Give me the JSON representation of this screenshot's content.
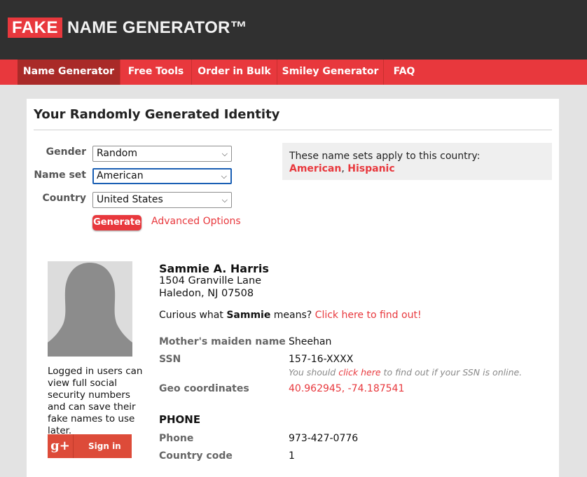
{
  "header": {
    "logo_fake": "FAKE",
    "logo_rest": "NAME GENERATOR™"
  },
  "nav": {
    "items": [
      {
        "label": "Name Generator",
        "active": true
      },
      {
        "label": "Free Tools"
      },
      {
        "label": "Order in Bulk"
      },
      {
        "label": "Smiley Generator"
      },
      {
        "label": "FAQ"
      }
    ]
  },
  "main": {
    "title": "Your Randomly Generated Identity"
  },
  "form": {
    "gender_label": "Gender",
    "gender_value": "Random",
    "nameset_label": "Name set",
    "nameset_value": "American",
    "country_label": "Country",
    "country_value": "United States",
    "generate_label": "Generate",
    "advanced_label": "Advanced Options"
  },
  "info": {
    "text": "These name sets apply to this country:",
    "link1": "American",
    "sep": ",",
    "link2": "Hispanic"
  },
  "sidebar": {
    "login_note": "Logged in users can view full social security numbers and can save their fake names to use later.",
    "gplus_icon_text": "g+",
    "signin_label": "Sign in"
  },
  "identity": {
    "name": "Sammie A. Harris",
    "address_line1": "1504 Granville Lane",
    "address_line2": "Haledon, NJ 07508",
    "curious_prefix": "Curious what",
    "curious_name": "Sammie",
    "curious_mid": "means?",
    "curious_link": "Click here to find out!",
    "maiden_label": "Mother's maiden name",
    "maiden_value": "Sheehan",
    "ssn_label": "SSN",
    "ssn_value": "157-16-XXXX",
    "ssn_note_prefix": "You should",
    "ssn_note_link": "click here",
    "ssn_note_suffix": "to find out if your SSN is online.",
    "geo_label": "Geo coordinates",
    "geo_value": "40.962945, -74.187541",
    "phone_section": "PHONE",
    "phone_label": "Phone",
    "phone_value": "973-427-0776",
    "country_code_label": "Country code",
    "country_code_value": "1"
  },
  "icons": {
    "chevron": "chevron-down-icon",
    "avatar": "avatar-silhouette-icon",
    "gplus": "google-plus-icon"
  },
  "colors": {
    "brand_red": "#e8383d",
    "active_nav": "#a92a28",
    "header_bg": "#303030",
    "page_bg": "#e3e3e3"
  }
}
